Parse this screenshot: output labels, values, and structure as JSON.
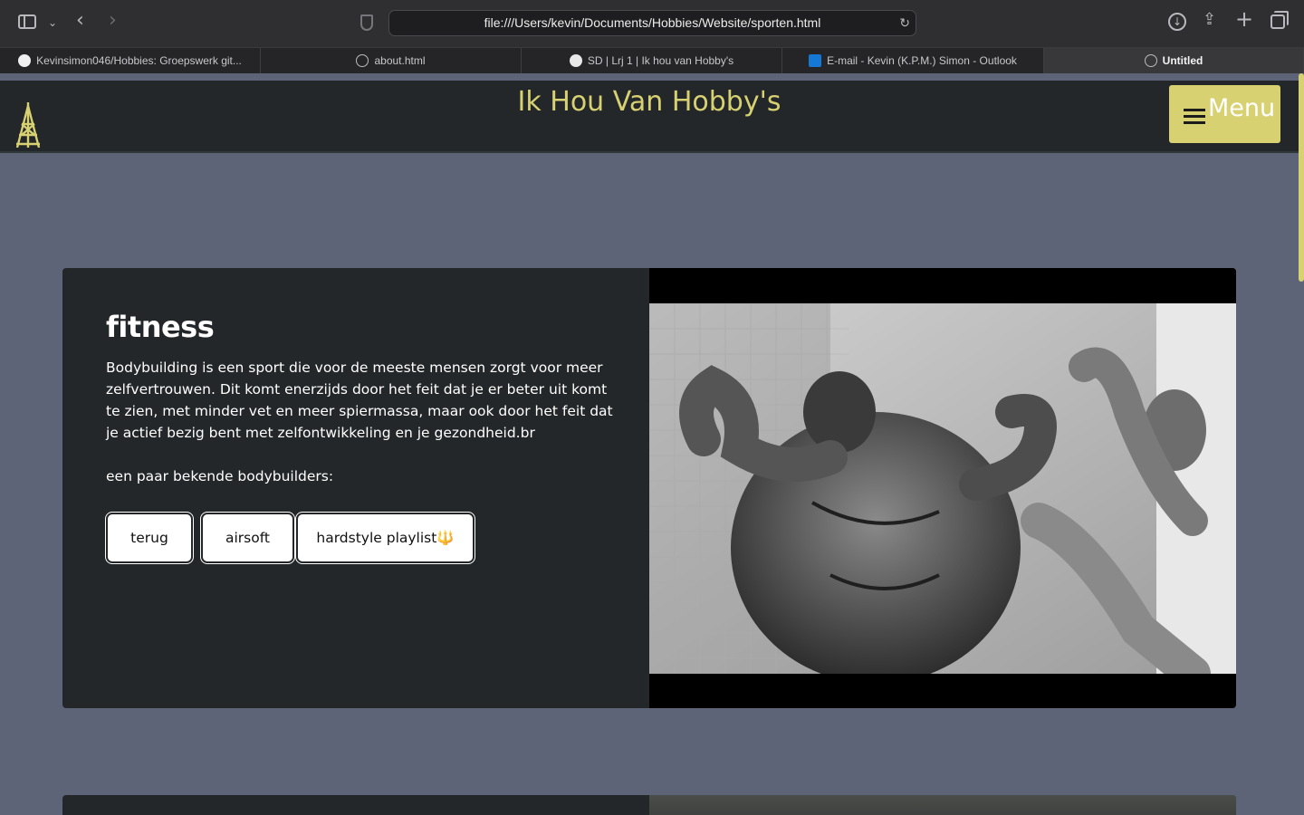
{
  "browser": {
    "url": "file:///Users/kevin/Documents/Hobbies/Website/sporten.html",
    "tabs": [
      {
        "label": "Kevinsimon046/Hobbies: Groepswerk git...",
        "favicon": "github-icon"
      },
      {
        "label": "about.html",
        "favicon": "compass-icon"
      },
      {
        "label": "SD | Lrj 1 | Ik hou van Hobby's",
        "favicon": "globe-icon"
      },
      {
        "label": "E-mail - Kevin (K.P.M.) Simon - Outlook",
        "favicon": "outlook-icon"
      },
      {
        "label": "Untitled",
        "favicon": "compass-icon",
        "active": true
      }
    ]
  },
  "site": {
    "title": "Ik Hou Van Hobby's",
    "menu_label": "Menu",
    "accent_color": "#d7d172",
    "header_color": "#232729",
    "page_background": "#5d6478"
  },
  "card": {
    "title": "fitness",
    "body": "Bodybuilding is een sport die voor de meeste mensen zorgt voor meer zelfvertrouwen. Dit komt enerzijds door het feit dat je er beter uit komt te zien, met minder vet en meer spiermassa, maar ook door het feit dat je actief bezig bent met zelfontwikkeling en je gezondheid.br",
    "subtitle": "een paar bekende bodybuilders:",
    "buttons": [
      "terug",
      "airsoft",
      "hardstyle playlist🔱"
    ]
  }
}
